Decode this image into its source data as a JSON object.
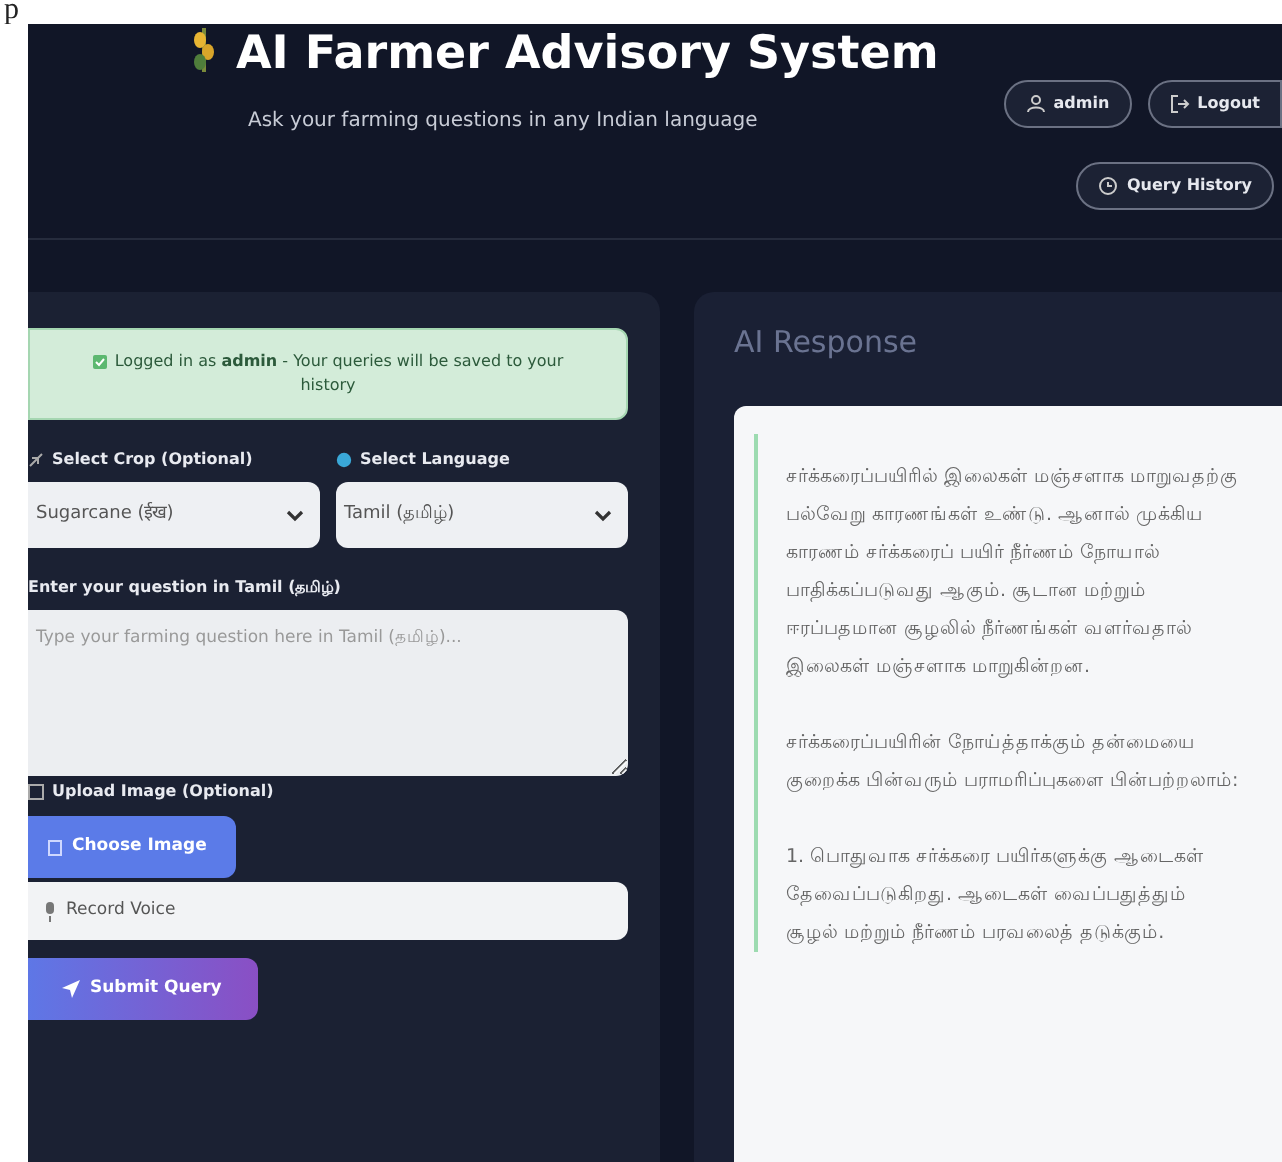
{
  "stray_text": "p",
  "header": {
    "title": "AI Farmer Advisory System",
    "subtitle": "Ask your farming questions in any Indian language",
    "buttons": [
      {
        "label": "admin",
        "kind": "user"
      },
      {
        "label": "Logout",
        "kind": "logout"
      },
      {
        "label": "Query History",
        "kind": "history"
      }
    ]
  },
  "query_form": {
    "alert": "Logged in as **admin** - Your queries will be saved to your history",
    "crop_label": "Select Crop (Optional)",
    "crop_value": "Sugarcane (ईख)",
    "language_label": "Select Language",
    "language_value": "Tamil (தமிழ்)",
    "question_label": "Enter your question in Tamil (தமிழ்)",
    "question_placeholder": "Type your farming question here in Tamil (தமிழ்)...",
    "upload_label": "Upload Image (Optional)",
    "choose_image_button": "Choose Image",
    "record_voice_button": "Record Voice",
    "submit_button": "Submit Query"
  },
  "response": {
    "title": "AI Response",
    "paragraphs": [
      "சர்க்கரைப்பயிரில் இலைகள் மஞ்சளாக மாறுவதற்கு பல்வேறு காரணங்கள் உண்டு. ஆனால் முக்கிய காரணம் சர்க்கரைப் பயிர் நீர்ணம் நோயால் பாதிக்கப்படுவது ஆகும். சூடான மற்றும் ஈரப்பதமான சூழலில் நீர்ணங்கள் வளர்வதால் இலைகள் மஞ்சளாக மாறுகின்றன.",
      "சர்க்கரைப்பயிரின் நோய்த்தாக்கும் தன்மையை குறைக்க பின்வரும் பராமரிப்புகளை பின்பற்றலாம்:",
      "1. பொதுவாக சர்க்கரை பயிர்களுக்கு ஆடைகள் தேவைப்படுகிறது. ஆடைகள் வைப்பதுத்தும் சூழல் மற்றும் நீர்ணம் பரவலைத் தடுக்கும்."
    ]
  }
}
